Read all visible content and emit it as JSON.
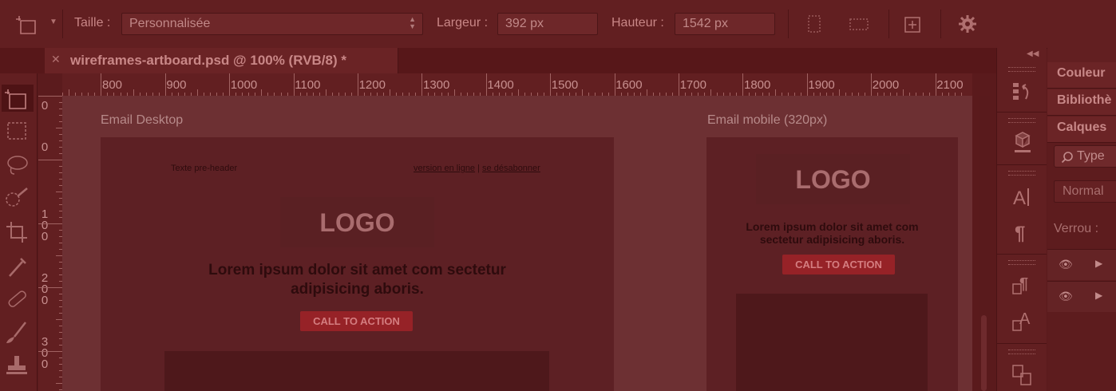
{
  "options_bar": {
    "size_label": "Taille :",
    "size_value": "Personnalisée",
    "width_label": "Largeur :",
    "width_value": "392 px",
    "height_label": "Hauteur :",
    "height_value": "1542 px"
  },
  "document_tab": {
    "title": "wireframes-artboard.psd @ 100% (RVB/8) *"
  },
  "ruler": {
    "horizontal": [
      "800",
      "900",
      "1000",
      "1100",
      "1200",
      "1300",
      "1400",
      "1500",
      "1600",
      "1700",
      "1800",
      "1900",
      "2000",
      "2100"
    ],
    "vertical_zero": "0",
    "vertical": [
      "0",
      "1\n0\n0",
      "2\n0\n0",
      "3\n0\n0"
    ]
  },
  "artboards": {
    "desktop": {
      "label": "Email Desktop",
      "preheader": "Texte pre-header",
      "link_online": "version en ligne",
      "link_sep": " | ",
      "link_unsub": "se désabonner",
      "logo": "LOGO",
      "headline_1": "Lorem ipsum dolor sit amet com sectetur",
      "headline_2": "adipisicing aboris.",
      "cta": "CALL TO ACTION"
    },
    "mobile": {
      "label": "Email mobile (320px)",
      "logo": "LOGO",
      "headline_1": "Lorem ipsum dolor sit amet com",
      "headline_2": "sectetur adipisicing aboris.",
      "cta": "CALL TO ACTION"
    }
  },
  "panels": {
    "tabs": [
      "Couleur",
      "Bibliothè",
      "Calques"
    ],
    "search_placeholder": "Type",
    "blend_mode": "Normal",
    "lock_label": "Verrou :"
  },
  "colors": {
    "overlay_tint": "#5a1a1c",
    "cta": "#962227"
  }
}
